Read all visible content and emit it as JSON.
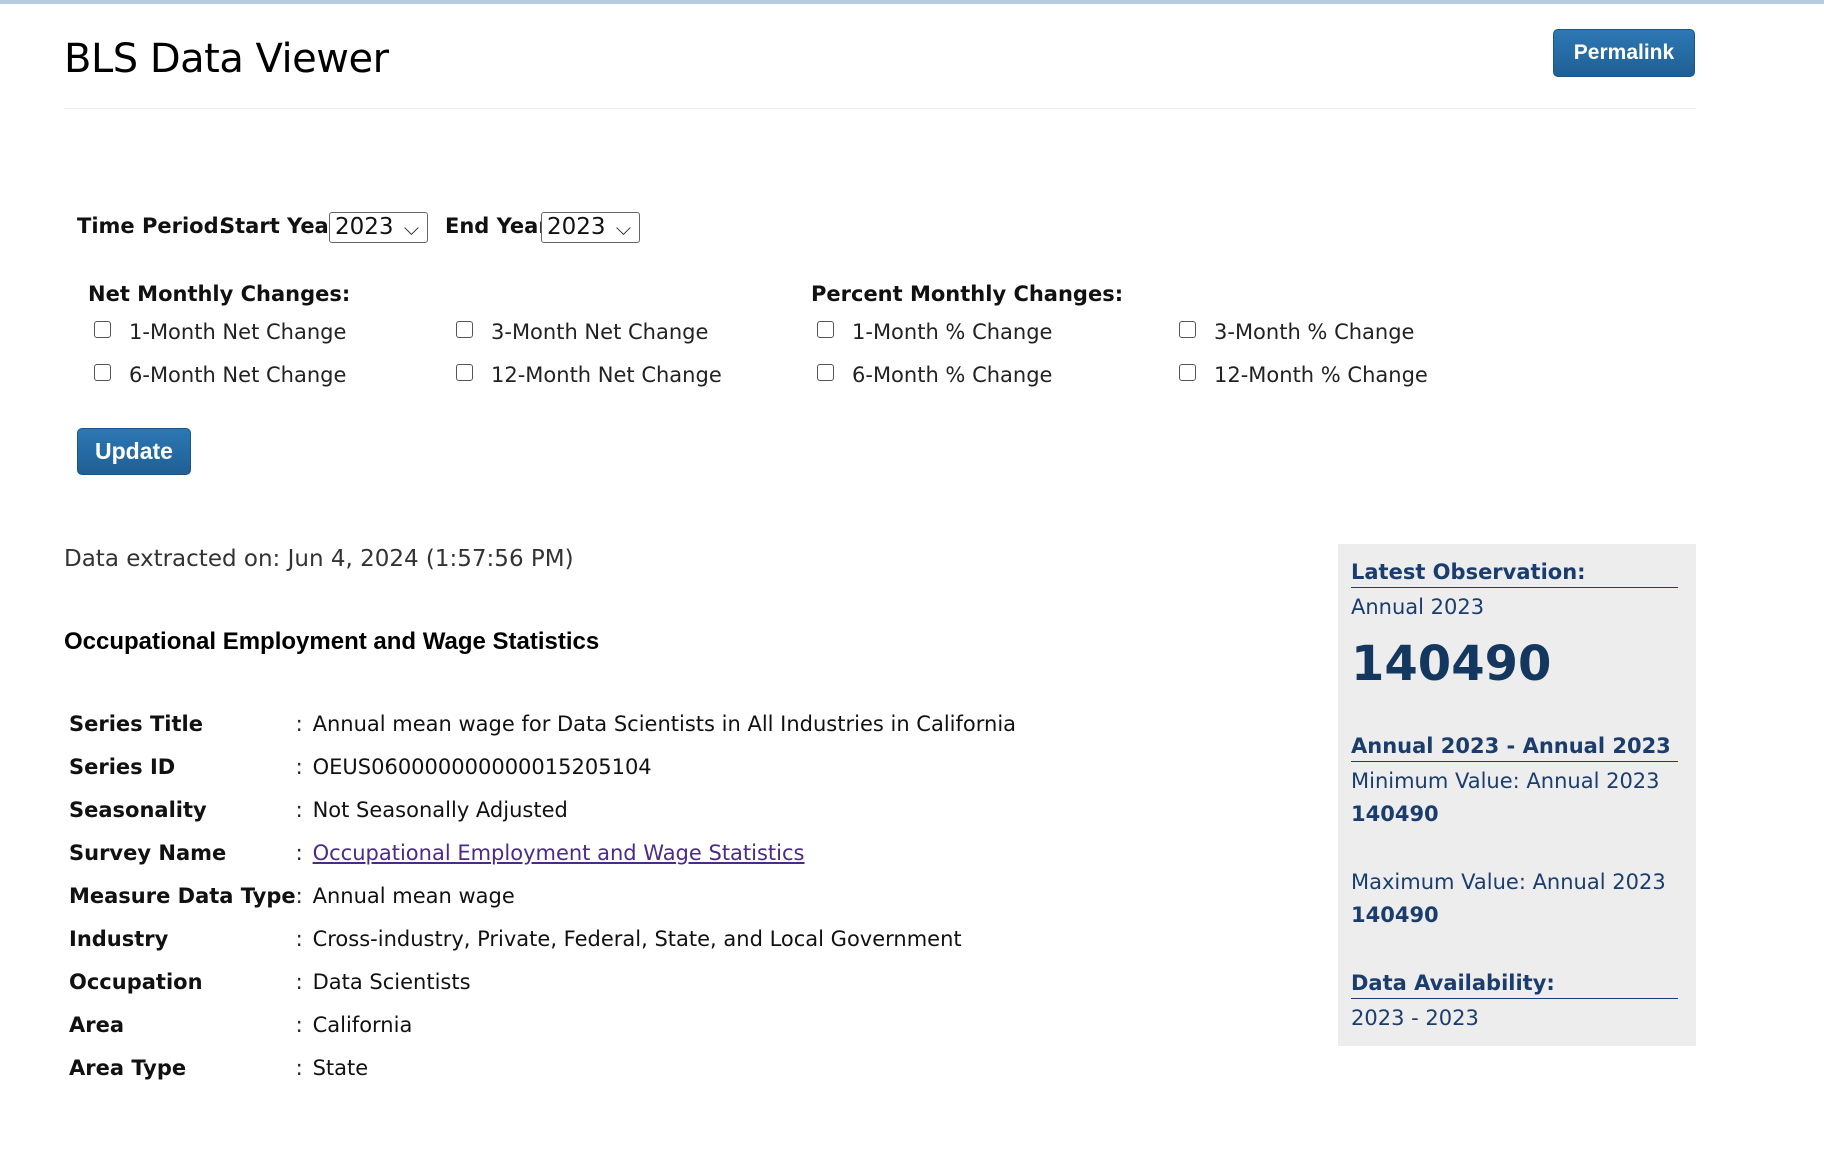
{
  "header": {
    "title": "BLS Data Viewer",
    "permalink_label": "Permalink"
  },
  "time_period": {
    "label": "Time Period:",
    "start_year_label": "Start Year:",
    "start_year_value": "2023",
    "end_year_label": "End Year:",
    "end_year_value": "2023"
  },
  "net_changes": {
    "title": "Net Monthly Changes:",
    "options": [
      {
        "label": "1-Month Net Change",
        "checked": false
      },
      {
        "label": "3-Month Net Change",
        "checked": false
      },
      {
        "label": "6-Month Net Change",
        "checked": false
      },
      {
        "label": "12-Month Net Change",
        "checked": false
      }
    ]
  },
  "percent_changes": {
    "title": "Percent Monthly Changes:",
    "options": [
      {
        "label": "1-Month % Change",
        "checked": false
      },
      {
        "label": "3-Month % Change",
        "checked": false
      },
      {
        "label": "6-Month % Change",
        "checked": false
      },
      {
        "label": "12-Month % Change",
        "checked": false
      }
    ]
  },
  "update_label": "Update",
  "extraction": "Data extracted on: Jun 4, 2024 (1:57:56 PM)",
  "survey_heading": "Occupational Employment and Wage Statistics",
  "metadata": [
    {
      "key": "Series Title",
      "value": "Annual mean wage for Data Scientists in All Industries in California"
    },
    {
      "key": "Series ID",
      "value": "OEUS060000000000015205104"
    },
    {
      "key": "Seasonality",
      "value": "Not Seasonally Adjusted"
    },
    {
      "key": "Survey Name",
      "value": "Occupational Employment and Wage Statistics"
    },
    {
      "key": "Measure Data Type",
      "value": "Annual mean wage"
    },
    {
      "key": "Industry",
      "value": "Cross-industry, Private, Federal, State, and Local Government"
    },
    {
      "key": "Occupation",
      "value": "Data Scientists"
    },
    {
      "key": "Area",
      "value": "California"
    },
    {
      "key": "Area Type",
      "value": "State"
    }
  ],
  "separator": ":",
  "side_panel": {
    "latest_title": "Latest Observation:",
    "latest_period": "Annual 2023",
    "latest_value": "140490",
    "range_title": "Annual 2023 - Annual 2023",
    "min_label": "Minimum Value: Annual 2023",
    "min_value": "140490",
    "max_label": "Maximum Value: Annual 2023",
    "max_value": "140490",
    "availability_title": "Data Availability:",
    "availability_range": "2023 - 2023"
  },
  "colors": {
    "button_blue": "#2068a3",
    "panel_text_navy": "#1a3d6d",
    "panel_background": "#ededed",
    "link_purple": "#4b2a8a"
  }
}
